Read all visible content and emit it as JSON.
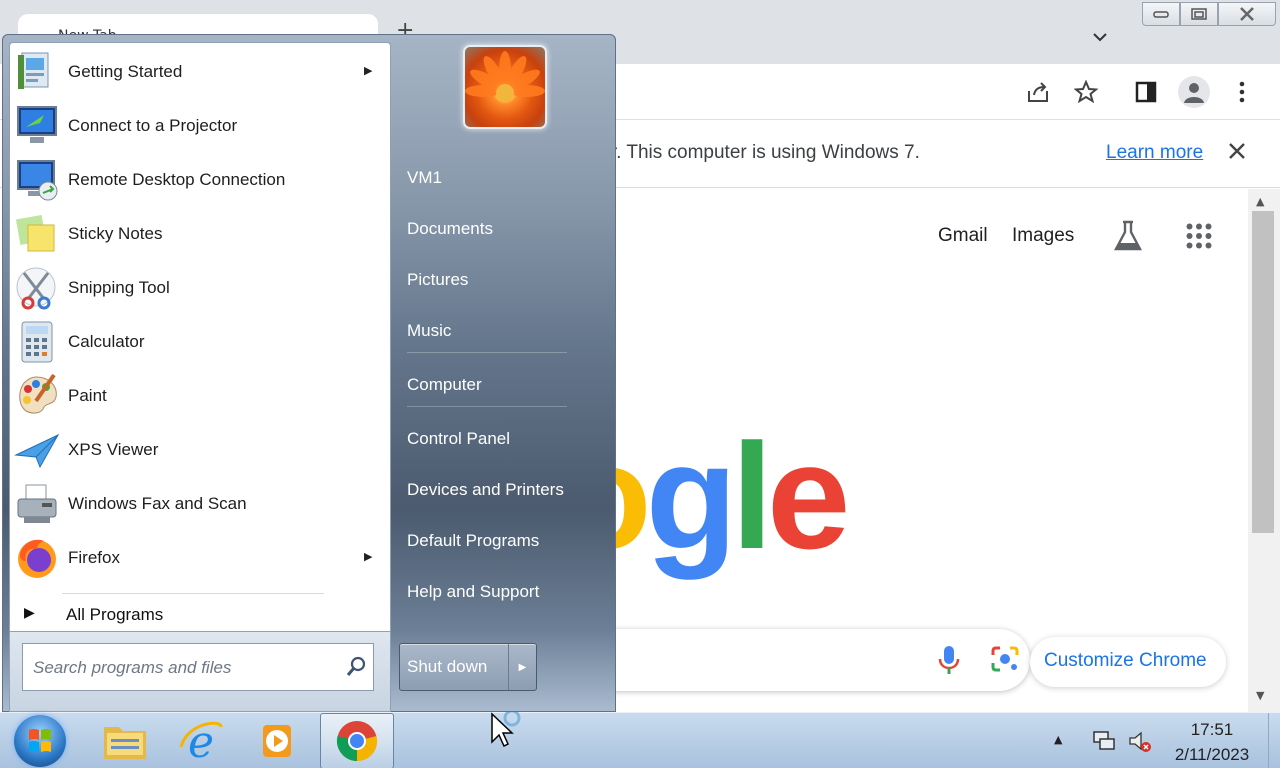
{
  "chrome": {
    "tab_title": "New Tab",
    "new_tab_glyph": "+",
    "infobar_text": "ter. This computer is using Windows 7.",
    "infobar_link": "Learn more",
    "gmail": "Gmail",
    "images": "Images",
    "logo_letters": [
      "o",
      "g",
      "l",
      "e"
    ],
    "logo_colors": [
      "#fbbc05",
      "#4285f4",
      "#34a853",
      "#ea4335"
    ],
    "customize_label": "Customize Chrome",
    "icons": [
      "share-icon",
      "star-icon",
      "side-panel-icon",
      "profile-icon",
      "kebab-menu-icon",
      "labs-icon",
      "apps-grid-icon",
      "mic-icon",
      "lens-camera-icon"
    ]
  },
  "start_menu": {
    "programs": [
      {
        "label": "Getting Started",
        "icon": "getting-started-icon",
        "has_submenu": true
      },
      {
        "label": "Connect to a Projector",
        "icon": "projector-icon",
        "has_submenu": false
      },
      {
        "label": "Remote Desktop Connection",
        "icon": "remote-desktop-icon",
        "has_submenu": false
      },
      {
        "label": "Sticky Notes",
        "icon": "sticky-notes-icon",
        "has_submenu": false
      },
      {
        "label": "Snipping Tool",
        "icon": "scissors-icon",
        "has_submenu": false
      },
      {
        "label": "Calculator",
        "icon": "calculator-icon",
        "has_submenu": false
      },
      {
        "label": "Paint",
        "icon": "paint-palette-icon",
        "has_submenu": false
      },
      {
        "label": "XPS Viewer",
        "icon": "xps-viewer-icon",
        "has_submenu": false
      },
      {
        "label": "Windows Fax and Scan",
        "icon": "fax-icon",
        "has_submenu": false
      },
      {
        "label": "Firefox",
        "icon": "firefox-icon",
        "has_submenu": true
      }
    ],
    "all_programs": "All Programs",
    "search_placeholder": "Search programs and files",
    "right_items": [
      "VM1",
      "Documents",
      "Pictures",
      "Music",
      "Computer",
      "Control Panel",
      "Devices and Printers",
      "Default Programs",
      "Help and Support"
    ],
    "shutdown_label": "Shut down"
  },
  "taskbar": {
    "apps": [
      "explorer-icon",
      "internet-explorer-icon",
      "media-player-icon",
      "chrome-icon"
    ],
    "active_app": "chrome-icon",
    "time": "17:51",
    "date": "2/11/2023"
  }
}
